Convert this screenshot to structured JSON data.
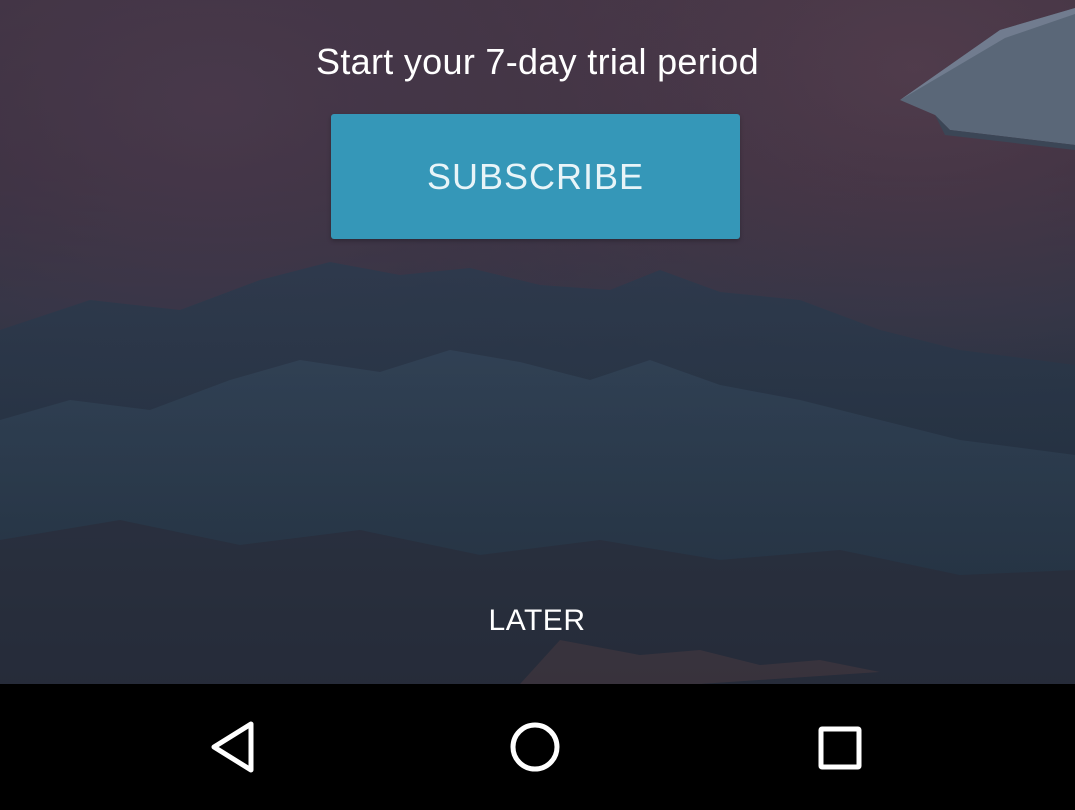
{
  "trial": {
    "title": "Start your 7-day trial period"
  },
  "actions": {
    "subscribe_label": "SUBSCRIBE",
    "later_label": "LATER"
  },
  "navbar": {
    "back_icon": "back-triangle-icon",
    "home_icon": "home-circle-icon",
    "recents_icon": "recents-square-icon"
  },
  "colors": {
    "subscribe_button": "#3597b8",
    "navbar": "#000000",
    "text": "#ffffff"
  }
}
